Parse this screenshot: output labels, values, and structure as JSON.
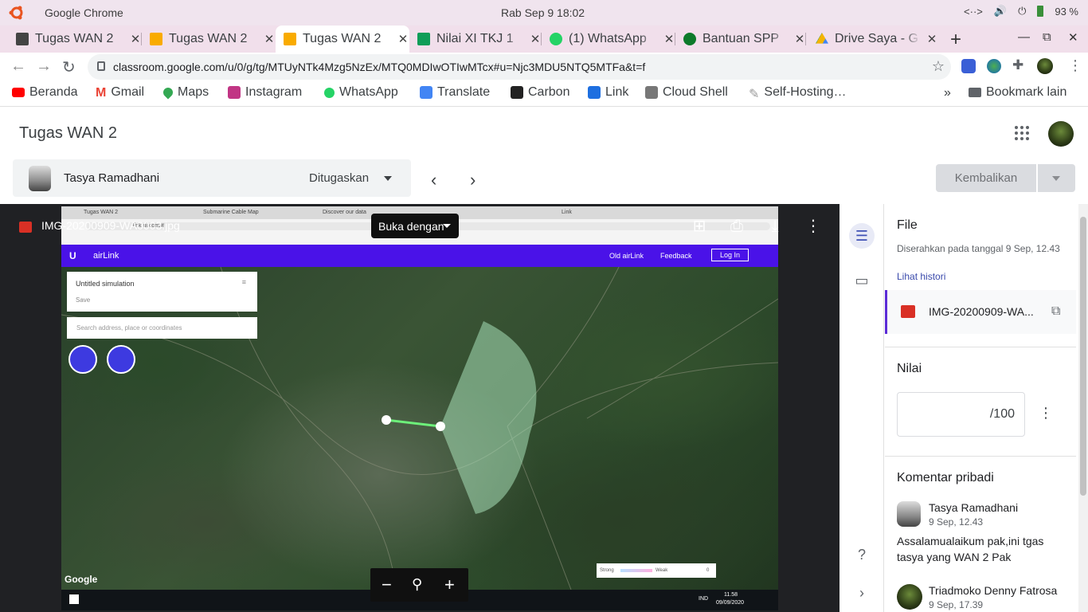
{
  "os": {
    "app_name": "Google Chrome",
    "clock": "Rab Sep 9  18:02",
    "battery": "93 %"
  },
  "tabs": [
    {
      "title": "Tugas WAN 2",
      "color": "#444444"
    },
    {
      "title": "Tugas WAN 2",
      "color": "#f9ab00"
    },
    {
      "title": "Tugas WAN 2",
      "color": "#f9ab00"
    },
    {
      "title": "Nilai XI TKJ 1",
      "color": "#0f9d58"
    },
    {
      "title": "(1) WhatsApp",
      "color": "#25d366"
    },
    {
      "title": "Bantuan SPP",
      "color": "#0c7a2a"
    },
    {
      "title": "Drive Saya - G",
      "color": "#4285f4"
    }
  ],
  "omnibox": {
    "url": "classroom.google.com/u/0/g/tg/MTUyNTk4Mzg5NzEx/MTQ0MDIwOTIwMTcx#u=Njc3MDU5NTQ5MTFa&t=f"
  },
  "bookmarks": [
    {
      "label": "Beranda",
      "color": "#ff0000"
    },
    {
      "label": "Gmail",
      "color": "#ea4335"
    },
    {
      "label": "Maps",
      "color": "#34a853"
    },
    {
      "label": "Instagram",
      "color": "#c13584"
    },
    {
      "label": "WhatsApp",
      "color": "#25d366"
    },
    {
      "label": "Translate",
      "color": "#4285f4"
    },
    {
      "label": "Carbon",
      "color": "#222222"
    },
    {
      "label": "Link",
      "color": "#1e6fe0"
    },
    {
      "label": "Cloud Shell",
      "color": "#777777"
    },
    {
      "label": "Self-Hosting…",
      "color": "#999999"
    }
  ],
  "bookmarks_other": "Bookmark lain",
  "classroom": {
    "title": "Tugas WAN 2",
    "student_name": "Tasya Ramadhani",
    "status": "Ditugaskan",
    "return_button": "Kembalikan"
  },
  "viewer": {
    "file_name": "IMG-20200909-WA0003.jpg",
    "open_with": "Buka dengan",
    "shot": {
      "tabs": [
        "Tugas WAN 2",
        "Submarine Cable Map",
        "Discover our data",
        "Link"
      ],
      "url": "link.ui.com/#",
      "app": "airLink",
      "nav": [
        "Old airLink",
        "Feedback",
        "Log In"
      ],
      "sim_title": "Untitled simulation",
      "sim_save": "Save",
      "search_placeholder": "Search address, place or coordinates",
      "legend_strong": "Strong",
      "legend_weak": "Weak",
      "legend_count": "0",
      "google": "Google",
      "taskbar_time": "11.58",
      "taskbar_date": "09/09/2020",
      "taskbar_lang": "IND"
    }
  },
  "side": {
    "file_heading": "File",
    "submitted": "Diserahkan pada tanggal 9 Sep, 12.43",
    "history": "Lihat histori",
    "attachment": "IMG-20200909-WA...",
    "grade_heading": "Nilai",
    "grade_suffix": "/100",
    "comments_heading": "Komentar pribadi",
    "comments": [
      {
        "author": "Tasya Ramadhani",
        "date": "9 Sep, 12.43",
        "text": "Assalamualaikum pak,ini tgas tasya yang WAN 2 Pak"
      },
      {
        "author": "Triadmoko Denny Fatrosa",
        "date": "9 Sep, 17.39",
        "text": ""
      }
    ]
  }
}
